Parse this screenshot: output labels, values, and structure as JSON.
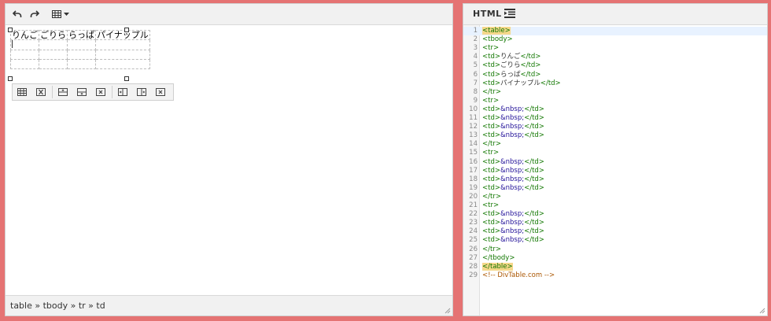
{
  "editor": {
    "toolbar": {
      "undo_icon": "undo-icon",
      "redo_icon": "redo-icon",
      "table_icon": "table-icon"
    },
    "table": {
      "rows": [
        [
          "りんご",
          "ごりら",
          "らっぱ",
          "パイナップル"
        ],
        [
          "",
          "",
          "",
          ""
        ],
        [
          "",
          "",
          "",
          ""
        ],
        [
          "",
          "",
          "",
          ""
        ]
      ]
    },
    "table_toolbar": [
      "table-properties-icon",
      "delete-table-icon",
      "insert-row-before-icon",
      "insert-row-after-icon",
      "delete-row-icon",
      "insert-column-before-icon",
      "insert-column-after-icon",
      "delete-column-icon"
    ],
    "status_path": "table » tbody » tr » td"
  },
  "code": {
    "title": "HTML",
    "format_icon": "indent-format-icon",
    "lines": [
      "<table>",
      "<tbody>",
      "<tr>",
      "<td>りんご</td>",
      "<td>ごりら</td>",
      "<td>らっぱ</td>",
      "<td>パイナップル</td>",
      "</tr>",
      "<tr>",
      "<td>&nbsp;</td>",
      "<td>&nbsp;</td>",
      "<td>&nbsp;</td>",
      "<td>&nbsp;</td>",
      "</tr>",
      "<tr>",
      "<td>&nbsp;</td>",
      "<td>&nbsp;</td>",
      "<td>&nbsp;</td>",
      "<td>&nbsp;</td>",
      "</tr>",
      "<tr>",
      "<td>&nbsp;</td>",
      "<td>&nbsp;</td>",
      "<td>&nbsp;</td>",
      "<td>&nbsp;</td>",
      "</tr>",
      "</tbody>",
      "</table>",
      "<!-- DivTable.com -->"
    ]
  },
  "colors": {
    "frame": "#e57373",
    "tag": "#117700",
    "entity": "#221199",
    "comment": "#aa5500",
    "tag_highlight": "#f5d78a"
  }
}
